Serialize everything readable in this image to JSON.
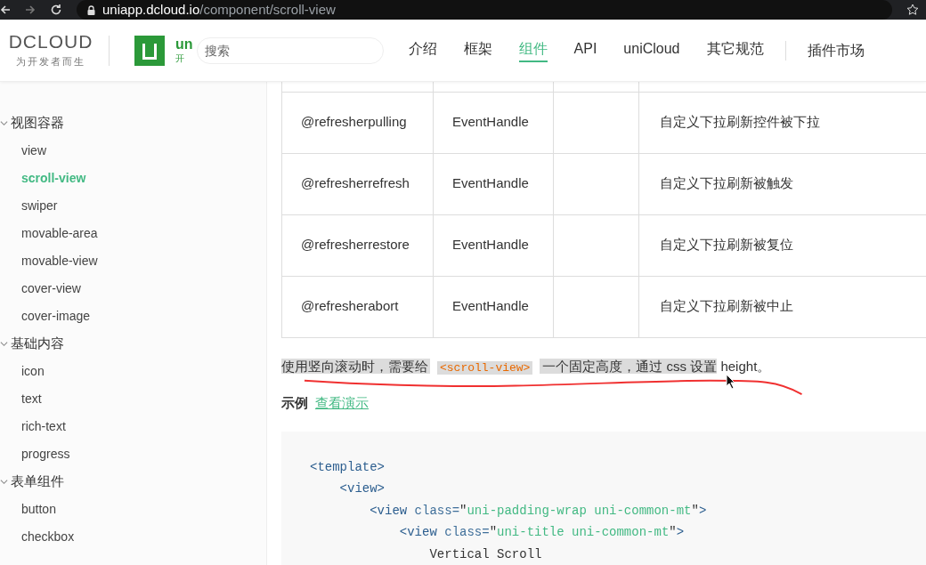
{
  "browser": {
    "url_host": "uniapp.dcloud.io",
    "url_path": "/component/scroll-view"
  },
  "header": {
    "brand": {
      "name": "DCLOUD",
      "tagline": "为开发者而生"
    },
    "product": {
      "title": "un",
      "subtitle": "开"
    },
    "search": {
      "placeholder": "搜索"
    },
    "nav": [
      {
        "label": "介绍",
        "selected": false
      },
      {
        "label": "框架",
        "selected": false
      },
      {
        "label": "组件",
        "selected": true
      },
      {
        "label": "API",
        "selected": false
      },
      {
        "label": "uniCloud",
        "selected": false
      },
      {
        "label": "其它规范",
        "selected": false
      }
    ],
    "market": "插件市场"
  },
  "sidebar": {
    "groups": [
      {
        "label": "视图容器",
        "expanded": true,
        "children": [
          {
            "label": "view",
            "selected": false
          },
          {
            "label": "scroll-view",
            "selected": true
          },
          {
            "label": "swiper",
            "selected": false
          },
          {
            "label": "movable-area",
            "selected": false
          },
          {
            "label": "movable-view",
            "selected": false
          },
          {
            "label": "cover-view",
            "selected": false
          },
          {
            "label": "cover-image",
            "selected": false
          }
        ]
      },
      {
        "label": "基础内容",
        "expanded": true,
        "children": [
          {
            "label": "icon",
            "selected": false
          },
          {
            "label": "text",
            "selected": false
          },
          {
            "label": "rich-text",
            "selected": false
          },
          {
            "label": "progress",
            "selected": false
          }
        ]
      },
      {
        "label": "表单组件",
        "expanded": true,
        "children": [
          {
            "label": "button",
            "selected": false
          },
          {
            "label": "checkbox",
            "selected": false
          }
        ]
      }
    ]
  },
  "table": {
    "rows": [
      [
        "@refresherpulling",
        "EventHandle",
        "",
        "自定义下拉刷新控件被下拉"
      ],
      [
        "@refresherrefresh",
        "EventHandle",
        "",
        "自定义下拉刷新被触发"
      ],
      [
        "@refresherrestore",
        "EventHandle",
        "",
        "自定义下拉刷新被复位"
      ],
      [
        "@refresherabort",
        "EventHandle",
        "",
        "自定义下拉刷新被中止"
      ]
    ]
  },
  "note": [
    {
      "kind": "text",
      "text": "使用竖向滚动时，需要给",
      "highlighted": true
    },
    {
      "kind": "code",
      "text": "<scroll-view>",
      "highlighted": true
    },
    {
      "kind": "text",
      "text": "一个固定高度，通过 css 设置",
      "highlighted": true
    },
    {
      "kind": "text",
      "text": " height。",
      "highlighted": false
    }
  ],
  "example": {
    "label": "示例",
    "link": "查看演示"
  },
  "code": [
    [
      {
        "kind": "tag",
        "text": "<template>"
      }
    ],
    [
      {
        "kind": "tag",
        "text": "    <view>"
      }
    ],
    [
      {
        "kind": "tag",
        "text": "        <view"
      },
      {
        "kind": "attr",
        "text": " class="
      },
      {
        "kind": "plain",
        "text": "\""
      },
      {
        "kind": "string",
        "text": "uni-padding-wrap uni-common-mt"
      },
      {
        "kind": "plain",
        "text": "\""
      },
      {
        "kind": "tag",
        "text": ">"
      }
    ],
    [
      {
        "kind": "tag",
        "text": "            <view"
      },
      {
        "kind": "attr",
        "text": " class="
      },
      {
        "kind": "plain",
        "text": "\""
      },
      {
        "kind": "string",
        "text": "uni-title uni-common-mt"
      },
      {
        "kind": "plain",
        "text": "\""
      },
      {
        "kind": "tag",
        "text": ">"
      }
    ],
    [
      {
        "kind": "plain",
        "text": "                Vertical Scroll"
      }
    ]
  ]
}
